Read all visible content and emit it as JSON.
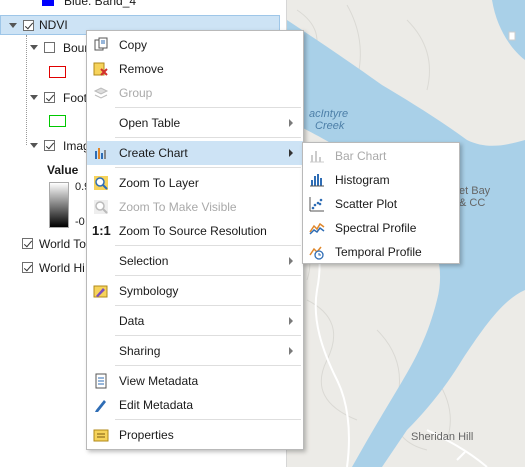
{
  "colors": {
    "selected_row": "#cde3f5",
    "blue_swatch": "#0000ff",
    "red_swatch": "#e00000",
    "green_swatch": "#00c800",
    "water": "#a9d0e8",
    "land": "#ecebe7"
  },
  "toc": {
    "blue_band_label": "Blue:  Band_4",
    "ndvi_label": "NDVI",
    "boundary_label": "Bour",
    "footprint_label": "Foot",
    "image_label": "Imag",
    "value_label": "Value",
    "ramp_high": "0.9",
    "ramp_low": "-0",
    "world_topo_label": "World To",
    "world_hillshade_label": "World Hi"
  },
  "context_menu": {
    "copy": "Copy",
    "remove": "Remove",
    "group": "Group",
    "open_table": "Open Table",
    "create_chart": "Create Chart",
    "zoom_to_layer": "Zoom To Layer",
    "zoom_to_make_visible": "Zoom To Make Visible",
    "zoom_to_source_resolution": "Zoom To Source Resolution",
    "selection": "Selection",
    "symbology": "Symbology",
    "data": "Data",
    "sharing": "Sharing",
    "view_metadata": "View Metadata",
    "edit_metadata": "Edit Metadata",
    "properties": "Properties"
  },
  "chart_submenu": {
    "bar_chart": "Bar Chart",
    "histogram": "Histogram",
    "scatter_plot": "Scatter Plot",
    "spectral_profile": "Spectral Profile",
    "temporal_profile": "Temporal Profile"
  },
  "map": {
    "label_macintyre": "acIntyre",
    "label_creek": "Creek",
    "label_bay": "et Bay",
    "label_cc": "& CC",
    "label_sheridan_hill": "Sheridan Hill"
  }
}
